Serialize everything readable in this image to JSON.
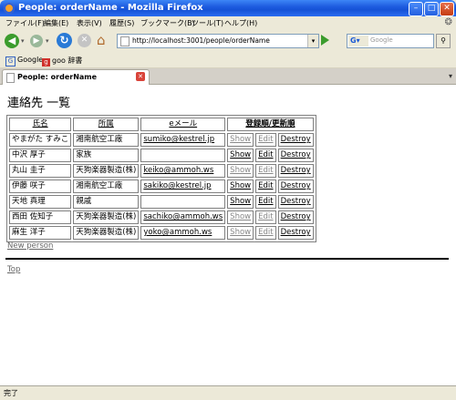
{
  "window": {
    "title": "People: orderName - Mozilla Firefox"
  },
  "menu": [
    "ファイル(F)",
    "編集(E)",
    "表示(V)",
    "履歴(S)",
    "ブックマーク(B)",
    "ツール(T)",
    "ヘルプ(H)"
  ],
  "nav": {
    "url": "http://localhost:3001/people/orderName",
    "search_placeholder": "Google",
    "search_engine": "G"
  },
  "bookmarks": [
    {
      "label": "Google",
      "icon": "G"
    },
    {
      "label": "goo 辞書",
      "icon": "g"
    }
  ],
  "tab": {
    "label": "People: orderName"
  },
  "page": {
    "heading": "連絡先 一覧",
    "columns": [
      "氏名",
      "所属",
      "eメール",
      "登録順/更新順"
    ],
    "rows": [
      {
        "name": "やまがた すみこ",
        "org": "湘南航空工廠",
        "email": "sumiko@kestrel.jp",
        "show": "Show",
        "edit": "Edit",
        "destroy": "Destroy",
        "greyed": true
      },
      {
        "name": "中沢 厚子",
        "org": "家族",
        "email": "",
        "show": "Show",
        "edit": "Edit",
        "destroy": "Destroy",
        "greyed": false
      },
      {
        "name": "丸山 圭子",
        "org": "天狗楽器製造(株)",
        "email": "keiko@ammoh.ws",
        "show": "Show",
        "edit": "Edit",
        "destroy": "Destroy",
        "greyed": true
      },
      {
        "name": "伊藤 咲子",
        "org": "湘南航空工廠",
        "email": "sakiko@kestrel.jp",
        "show": "Show",
        "edit": "Edit",
        "destroy": "Destroy",
        "greyed": false
      },
      {
        "name": "天地 真理",
        "org": "親戚",
        "email": "",
        "show": "Show",
        "edit": "Edit",
        "destroy": "Destroy",
        "greyed": false
      },
      {
        "name": "西田 佐知子",
        "org": "天狗楽器製造(株)",
        "email": "sachiko@ammoh.ws",
        "show": "Show",
        "edit": "Edit",
        "destroy": "Destroy",
        "greyed": true
      },
      {
        "name": "麻生 洋子",
        "org": "天狗楽器製造(株)",
        "email": "yoko@ammoh.ws",
        "show": "Show",
        "edit": "Edit",
        "destroy": "Destroy",
        "greyed": true
      }
    ],
    "new_link": "New person",
    "top_link": "Top"
  },
  "status": {
    "text": "完了"
  },
  "colors": {
    "titlebar": "#1e5ce0",
    "back_arrow": "#3b9c2d",
    "reload": "#2a7ad6"
  }
}
